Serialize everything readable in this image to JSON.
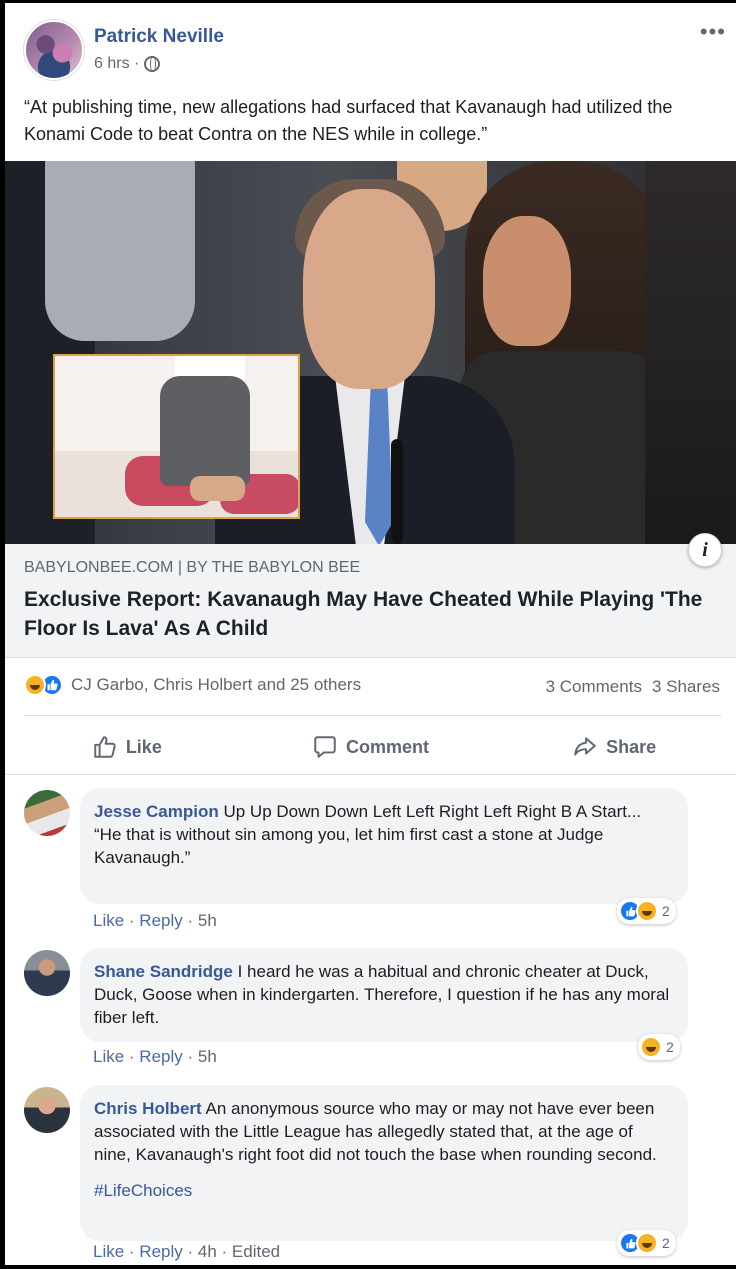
{
  "post": {
    "author": "Patrick Neville",
    "time": "6 hrs ·",
    "more": "•••",
    "text": "“At publishing time, new allegations had surfaced that Kavanaugh had utilized the Konami Code to beat Contra on the NES while in college.”"
  },
  "link": {
    "info_glyph": "i",
    "domain": "BABYLONBEE.COM | BY THE BABYLON BEE",
    "title": "Exclusive Report: Kavanaugh May Have Cheated While Playing 'The Floor Is Lava' As A Child"
  },
  "reactions": {
    "names": "CJ Garbo, Chris Holbert and 25 others",
    "comments": "3 Comments",
    "shares": "3 Shares"
  },
  "actions": {
    "like": "Like",
    "comment": "Comment",
    "share": "Share"
  },
  "comments": [
    {
      "author": "Jesse Campion",
      "text": "Up Up Down Down Left Left Right Left Right B A Start...\n“He that is without sin among you, let him first cast a stone at Judge Kavanaugh.”",
      "like": "Like",
      "reply": "Reply",
      "time": "5h",
      "reaction_count": "2"
    },
    {
      "author": "Shane Sandridge",
      "text": "I heard he was a habitual and chronic cheater at Duck, Duck, Goose when in kindergarten. Therefore, I question if he has any moral fiber left.",
      "like": "Like",
      "reply": "Reply",
      "time": "5h",
      "reaction_count": "2"
    },
    {
      "author": "Chris Holbert",
      "text": "An anonymous source who may or may not have ever been associated with the Little League has allegedly stated that, at the age of nine, Kavanaugh's right foot did not touch the base when rounding second.",
      "tag": "#LifeChoices",
      "like": "Like",
      "reply": "Reply",
      "time": "4h",
      "edited": "Edited",
      "reaction_count": "2"
    }
  ],
  "colors": {
    "link_blue": "#385898",
    "facebook_blue": "#1877f2",
    "haha_yellow": "#f7b125",
    "meta_gray": "#606770",
    "bubble_bg": "#f2f3f5"
  }
}
